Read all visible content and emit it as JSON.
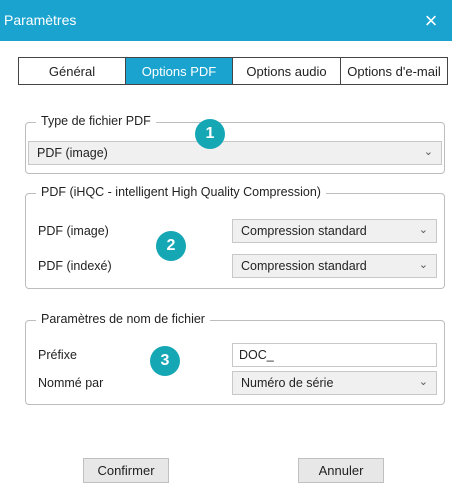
{
  "window": {
    "title": "Paramètres",
    "close_icon": "×"
  },
  "tabs": [
    {
      "label": "Général",
      "active": false
    },
    {
      "label": "Options PDF",
      "active": true
    },
    {
      "label": "Options audio",
      "active": false
    },
    {
      "label": "Options d'e-mail",
      "active": false
    }
  ],
  "group_file_type": {
    "legend": "Type de fichier PDF",
    "select_value": "PDF (image)",
    "marker": "1"
  },
  "group_compression": {
    "legend": "PDF (iHQC - intelligent High Quality Compression)",
    "row1_label": "PDF (image)",
    "row1_value": "Compression standard",
    "row2_label": "PDF (indexé)",
    "row2_value": "Compression standard",
    "marker": "2"
  },
  "group_filename": {
    "legend": "Paramètres de nom de fichier",
    "prefix_label": "Préfixe",
    "prefix_value": "DOC_",
    "named_by_label": "Nommé par",
    "named_by_value": "Numéro de série",
    "marker": "3"
  },
  "buttons": {
    "confirm": "Confirmer",
    "cancel": "Annuler"
  },
  "icons": {
    "chevron": "chevron-down-icon"
  },
  "colors": {
    "accent": "#1aa3cf",
    "marker": "#16a7b5"
  }
}
